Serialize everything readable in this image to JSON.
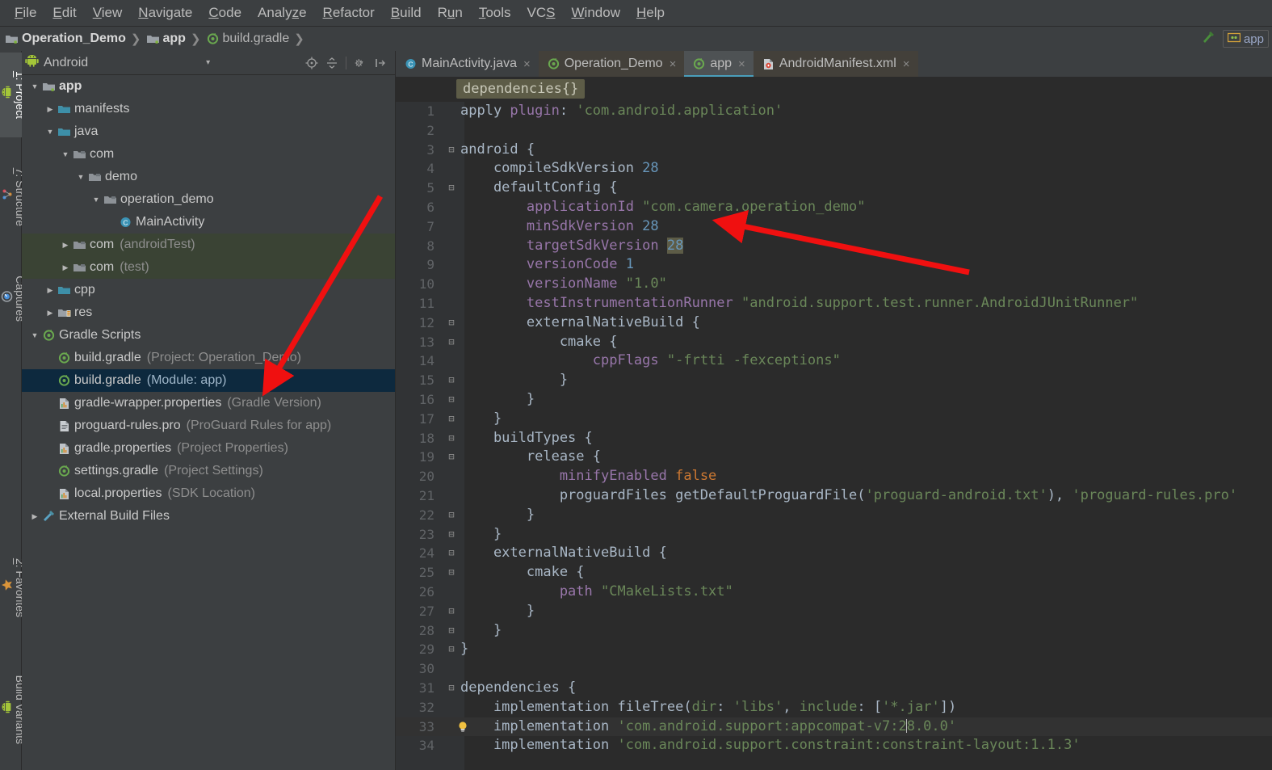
{
  "menu": {
    "items": [
      {
        "pre": "",
        "mn": "F",
        "post": "ile"
      },
      {
        "pre": "",
        "mn": "E",
        "post": "dit"
      },
      {
        "pre": "",
        "mn": "V",
        "post": "iew"
      },
      {
        "pre": "",
        "mn": "N",
        "post": "avigate"
      },
      {
        "pre": "",
        "mn": "C",
        "post": "ode"
      },
      {
        "pre": "Analy",
        "mn": "z",
        "post": "e"
      },
      {
        "pre": "",
        "mn": "R",
        "post": "efactor"
      },
      {
        "pre": "",
        "mn": "B",
        "post": "uild"
      },
      {
        "pre": "R",
        "mn": "u",
        "post": "n"
      },
      {
        "pre": "",
        "mn": "T",
        "post": "ools"
      },
      {
        "pre": "VC",
        "mn": "S",
        "post": ""
      },
      {
        "pre": "",
        "mn": "W",
        "post": "indow"
      },
      {
        "pre": "",
        "mn": "H",
        "post": "elp"
      }
    ]
  },
  "breadcrumb": {
    "items": [
      {
        "label": "Operation_Demo",
        "icon": "module-icon",
        "bold": true
      },
      {
        "label": "app",
        "icon": "module-icon",
        "bold": true
      },
      {
        "label": "build.gradle",
        "icon": "gradle-icon",
        "bold": false
      }
    ],
    "separator": "❯"
  },
  "toolbar_right": {
    "make_project_icon": "hammer-icon",
    "run_config_label": "app",
    "run_config_icon": "android-module-icon"
  },
  "tool_strip": {
    "left_top": [
      {
        "label": "1: Project",
        "mnemonic": "1",
        "icon": "android-icon",
        "active": true
      },
      {
        "label": "7: Structure",
        "mnemonic": "7",
        "icon": "structure-icon",
        "active": false
      },
      {
        "label": "Captures",
        "mnemonic": "",
        "icon": "captures-icon",
        "active": false
      }
    ],
    "left_bottom": [
      {
        "label": "2: Favorites",
        "mnemonic": "2",
        "icon": "star-icon",
        "active": false
      },
      {
        "label": "Build Variants",
        "mnemonic": "",
        "icon": "android-icon",
        "active": false
      }
    ]
  },
  "project_panel": {
    "title": "Android",
    "title_icon": "android-icon",
    "combo_arrow": "▾",
    "tools": [
      "target-icon",
      "collapse-all-icon",
      "settings-gear-icon",
      "hide-panel-icon"
    ],
    "tree": [
      {
        "indent": 0,
        "twist": "▼",
        "icon": "module-icon",
        "name": "app",
        "hint": "",
        "bold": true,
        "state": "normal"
      },
      {
        "indent": 1,
        "twist": "▶",
        "icon": "folder-icon",
        "name": "manifests",
        "hint": "",
        "bold": false,
        "state": "normal"
      },
      {
        "indent": 1,
        "twist": "▼",
        "icon": "folder-icon",
        "name": "java",
        "hint": "",
        "bold": false,
        "state": "normal"
      },
      {
        "indent": 2,
        "twist": "▼",
        "icon": "pkg-icon",
        "name": "com",
        "hint": "",
        "bold": false,
        "state": "normal"
      },
      {
        "indent": 3,
        "twist": "▼",
        "icon": "pkg-icon",
        "name": "demo",
        "hint": "",
        "bold": false,
        "state": "normal"
      },
      {
        "indent": 4,
        "twist": "▼",
        "icon": "pkg-icon",
        "name": "operation_demo",
        "hint": "",
        "bold": false,
        "state": "normal"
      },
      {
        "indent": 5,
        "twist": "",
        "icon": "class-icon",
        "name": "MainActivity",
        "hint": "",
        "bold": false,
        "state": "normal"
      },
      {
        "indent": 2,
        "twist": "▶",
        "icon": "pkg-icon",
        "name": "com",
        "hint": "(androidTest)",
        "bold": false,
        "state": "green"
      },
      {
        "indent": 2,
        "twist": "▶",
        "icon": "pkg-icon",
        "name": "com",
        "hint": "(test)",
        "bold": false,
        "state": "green"
      },
      {
        "indent": 1,
        "twist": "▶",
        "icon": "folder-icon",
        "name": "cpp",
        "hint": "",
        "bold": false,
        "state": "normal"
      },
      {
        "indent": 1,
        "twist": "▶",
        "icon": "res-icon",
        "name": "res",
        "hint": "",
        "bold": false,
        "state": "normal"
      },
      {
        "indent": 0,
        "twist": "▼",
        "icon": "gradle-icon",
        "name": "Gradle Scripts",
        "hint": "",
        "bold": false,
        "state": "normal"
      },
      {
        "indent": 1,
        "twist": "",
        "icon": "gradle-icon",
        "name": "build.gradle",
        "hint": "(Project: Operation_Demo)",
        "bold": false,
        "state": "normal"
      },
      {
        "indent": 1,
        "twist": "",
        "icon": "gradle-icon",
        "name": "build.gradle",
        "hint": "(Module: app)",
        "bold": false,
        "state": "selected"
      },
      {
        "indent": 1,
        "twist": "",
        "icon": "props-icon",
        "name": "gradle-wrapper.properties",
        "hint": "(Gradle Version)",
        "bold": false,
        "state": "normal"
      },
      {
        "indent": 1,
        "twist": "",
        "icon": "text-icon",
        "name": "proguard-rules.pro",
        "hint": "(ProGuard Rules for app)",
        "bold": false,
        "state": "normal"
      },
      {
        "indent": 1,
        "twist": "",
        "icon": "props-icon",
        "name": "gradle.properties",
        "hint": "(Project Properties)",
        "bold": false,
        "state": "normal"
      },
      {
        "indent": 1,
        "twist": "",
        "icon": "gradle-icon",
        "name": "settings.gradle",
        "hint": "(Project Settings)",
        "bold": false,
        "state": "normal"
      },
      {
        "indent": 1,
        "twist": "",
        "icon": "props-icon",
        "name": "local.properties",
        "hint": "(SDK Location)",
        "bold": false,
        "state": "normal"
      },
      {
        "indent": 0,
        "twist": "▶",
        "icon": "build-icon",
        "name": "External Build Files",
        "hint": "",
        "bold": false,
        "state": "normal"
      }
    ]
  },
  "editor": {
    "tabs": [
      {
        "label": "MainActivity.java",
        "icon": "java-class-icon",
        "state": "dim",
        "close": "×"
      },
      {
        "label": "Operation_Demo",
        "icon": "gradle-icon",
        "state": "shaded",
        "close": "×"
      },
      {
        "label": "app",
        "icon": "gradle-icon",
        "state": "active",
        "close": "×"
      },
      {
        "label": "AndroidManifest.xml",
        "icon": "manifest-icon",
        "state": "shaded",
        "close": "×"
      }
    ],
    "sticky_breadcrumb": "dependencies{}",
    "file_name": "build.gradle",
    "lines": [
      {
        "no": 1,
        "fold": "",
        "bulb": false,
        "hl": false,
        "tokens": [
          {
            "t": "apply ",
            "c": "d"
          },
          {
            "t": "plugin",
            "c": "ppty"
          },
          {
            "t": ": ",
            "c": "d"
          },
          {
            "t": "'com.android.application'",
            "c": "s"
          }
        ]
      },
      {
        "no": 2,
        "fold": "",
        "bulb": false,
        "hl": false,
        "tokens": []
      },
      {
        "no": 3,
        "fold": "⊟",
        "bulb": false,
        "hl": false,
        "tokens": [
          {
            "t": "android {",
            "c": "d"
          }
        ]
      },
      {
        "no": 4,
        "fold": "",
        "bulb": false,
        "hl": false,
        "tokens": [
          {
            "t": "    compileSdkVersion ",
            "c": "d"
          },
          {
            "t": "28",
            "c": "n"
          }
        ]
      },
      {
        "no": 5,
        "fold": "⊟",
        "bulb": false,
        "hl": false,
        "tokens": [
          {
            "t": "    defaultConfig {",
            "c": "d"
          }
        ]
      },
      {
        "no": 6,
        "fold": "",
        "bulb": false,
        "hl": false,
        "tokens": [
          {
            "t": "        applicationId ",
            "c": "ppty"
          },
          {
            "t": "\"com.camera.operation_demo\"",
            "c": "s"
          }
        ]
      },
      {
        "no": 7,
        "fold": "",
        "bulb": false,
        "hl": false,
        "tokens": [
          {
            "t": "        minSdkVersion ",
            "c": "ppty"
          },
          {
            "t": "28",
            "c": "n"
          }
        ]
      },
      {
        "no": 8,
        "fold": "",
        "bulb": false,
        "hl": false,
        "tokens": [
          {
            "t": "        targetSdkVersion ",
            "c": "ppty"
          },
          {
            "t": "28",
            "c": "hlnum"
          }
        ]
      },
      {
        "no": 9,
        "fold": "",
        "bulb": false,
        "hl": false,
        "tokens": [
          {
            "t": "        versionCode ",
            "c": "ppty"
          },
          {
            "t": "1",
            "c": "n"
          }
        ]
      },
      {
        "no": 10,
        "fold": "",
        "bulb": false,
        "hl": false,
        "tokens": [
          {
            "t": "        versionName ",
            "c": "ppty"
          },
          {
            "t": "\"1.0\"",
            "c": "s"
          }
        ]
      },
      {
        "no": 11,
        "fold": "",
        "bulb": false,
        "hl": false,
        "tokens": [
          {
            "t": "        testInstrumentationRunner ",
            "c": "ppty"
          },
          {
            "t": "\"android.support.test.runner.AndroidJUnitRunner\"",
            "c": "s"
          }
        ]
      },
      {
        "no": 12,
        "fold": "⊟",
        "bulb": false,
        "hl": false,
        "tokens": [
          {
            "t": "        externalNativeBuild {",
            "c": "d"
          }
        ]
      },
      {
        "no": 13,
        "fold": "⊟",
        "bulb": false,
        "hl": false,
        "tokens": [
          {
            "t": "            cmake {",
            "c": "d"
          }
        ]
      },
      {
        "no": 14,
        "fold": "",
        "bulb": false,
        "hl": false,
        "tokens": [
          {
            "t": "                cppFlags ",
            "c": "ppty"
          },
          {
            "t": "\"-frtti -fexceptions\"",
            "c": "s"
          }
        ]
      },
      {
        "no": 15,
        "fold": "⊟",
        "bulb": false,
        "hl": false,
        "tokens": [
          {
            "t": "            }",
            "c": "d"
          }
        ]
      },
      {
        "no": 16,
        "fold": "⊟",
        "bulb": false,
        "hl": false,
        "tokens": [
          {
            "t": "        }",
            "c": "d"
          }
        ]
      },
      {
        "no": 17,
        "fold": "⊟",
        "bulb": false,
        "hl": false,
        "tokens": [
          {
            "t": "    }",
            "c": "d"
          }
        ]
      },
      {
        "no": 18,
        "fold": "⊟",
        "bulb": false,
        "hl": false,
        "tokens": [
          {
            "t": "    buildTypes {",
            "c": "d"
          }
        ]
      },
      {
        "no": 19,
        "fold": "⊟",
        "bulb": false,
        "hl": false,
        "tokens": [
          {
            "t": "        release {",
            "c": "d"
          }
        ]
      },
      {
        "no": 20,
        "fold": "",
        "bulb": false,
        "hl": false,
        "tokens": [
          {
            "t": "            minifyEnabled ",
            "c": "ppty"
          },
          {
            "t": "false",
            "c": "k"
          }
        ]
      },
      {
        "no": 21,
        "fold": "",
        "bulb": false,
        "hl": false,
        "tokens": [
          {
            "t": "            proguardFiles getDefaultProguardFile(",
            "c": "d"
          },
          {
            "t": "'proguard-android.txt'",
            "c": "s"
          },
          {
            "t": "), ",
            "c": "d"
          },
          {
            "t": "'proguard-rules.pro'",
            "c": "s"
          }
        ]
      },
      {
        "no": 22,
        "fold": "⊟",
        "bulb": false,
        "hl": false,
        "tokens": [
          {
            "t": "        }",
            "c": "d"
          }
        ]
      },
      {
        "no": 23,
        "fold": "⊟",
        "bulb": false,
        "hl": false,
        "tokens": [
          {
            "t": "    }",
            "c": "d"
          }
        ]
      },
      {
        "no": 24,
        "fold": "⊟",
        "bulb": false,
        "hl": false,
        "tokens": [
          {
            "t": "    externalNativeBuild {",
            "c": "d"
          }
        ]
      },
      {
        "no": 25,
        "fold": "⊟",
        "bulb": false,
        "hl": false,
        "tokens": [
          {
            "t": "        cmake {",
            "c": "d"
          }
        ]
      },
      {
        "no": 26,
        "fold": "",
        "bulb": false,
        "hl": false,
        "tokens": [
          {
            "t": "            path ",
            "c": "ppty"
          },
          {
            "t": "\"CMakeLists.txt\"",
            "c": "s"
          }
        ]
      },
      {
        "no": 27,
        "fold": "⊟",
        "bulb": false,
        "hl": false,
        "tokens": [
          {
            "t": "        }",
            "c": "d"
          }
        ]
      },
      {
        "no": 28,
        "fold": "⊟",
        "bulb": false,
        "hl": false,
        "tokens": [
          {
            "t": "    }",
            "c": "d"
          }
        ]
      },
      {
        "no": 29,
        "fold": "⊟",
        "bulb": false,
        "hl": false,
        "tokens": [
          {
            "t": "}",
            "c": "d"
          }
        ]
      },
      {
        "no": 30,
        "fold": "",
        "bulb": false,
        "hl": false,
        "tokens": []
      },
      {
        "no": 31,
        "fold": "⊟",
        "bulb": false,
        "hl": false,
        "tokens": [
          {
            "t": "dependencies {",
            "c": "d"
          }
        ]
      },
      {
        "no": 32,
        "fold": "",
        "bulb": false,
        "hl": false,
        "tokens": [
          {
            "t": "    implementation fileTree(",
            "c": "d"
          },
          {
            "t": "dir",
            "c": "s"
          },
          {
            "t": ": ",
            "c": "d"
          },
          {
            "t": "'libs'",
            "c": "s"
          },
          {
            "t": ", ",
            "c": "d"
          },
          {
            "t": "include",
            "c": "s"
          },
          {
            "t": ": [",
            "c": "d"
          },
          {
            "t": "'*.jar'",
            "c": "s"
          },
          {
            "t": "])",
            "c": "d"
          }
        ]
      },
      {
        "no": 33,
        "fold": "",
        "bulb": true,
        "hl": true,
        "tokens": [
          {
            "t": "    implementation ",
            "c": "d"
          },
          {
            "t": "'com.android.support:appcompat-v7:2",
            "c": "s"
          },
          {
            "t": "|",
            "c": "caret"
          },
          {
            "t": "8.0.0'",
            "c": "s"
          }
        ]
      },
      {
        "no": 34,
        "fold": "",
        "bulb": false,
        "hl": false,
        "tokens": [
          {
            "t": "    implementation ",
            "c": "d"
          },
          {
            "t": "'com.android.support.constraint:constraint-layout:1.1.3'",
            "c": "s"
          }
        ]
      }
    ]
  },
  "annotations": {
    "arrow_1": {
      "color": "#f01010",
      "points": "sidebar build.gradle (Module: app)"
    },
    "arrow_2": {
      "color": "#f01010",
      "points": "applicationId com.camera.operation_demo"
    }
  },
  "colors": {
    "panel_bg": "#3c3f41",
    "editor_bg": "#2b2b2b",
    "gutter_bg": "#313335",
    "selection": "#0d293e",
    "test_src_bg": "#3a4334",
    "accent_tab": "#4a9ebb",
    "string": "#6a8759",
    "number": "#6897bb",
    "keyword": "#cc7832",
    "property": "#9876aa",
    "arrow": "#f01010"
  }
}
